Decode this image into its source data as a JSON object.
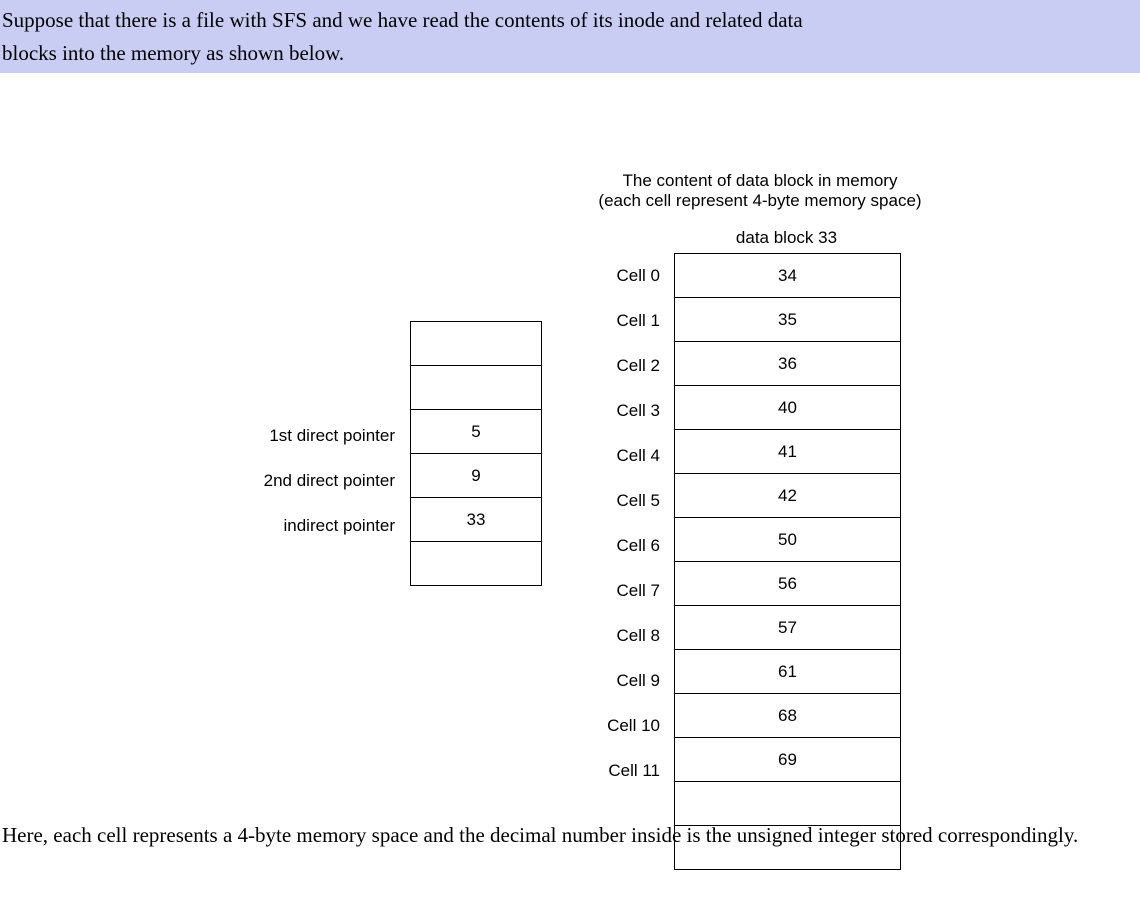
{
  "intro_line1": "Suppose that there is a file with SFS and we have read the contents of its inode and related data",
  "intro_line2": "blocks into the memory as shown below.",
  "caption_line1": "The content of data block in memory",
  "caption_line2": "(each cell represent 4-byte memory space)",
  "inode": {
    "labels": [
      "1st direct pointer",
      "2nd direct pointer",
      "indirect pointer"
    ],
    "values": [
      "",
      "",
      "5",
      "9",
      "33",
      ""
    ]
  },
  "block": {
    "title": "data block 33",
    "cells": [
      {
        "label": "Cell 0",
        "value": "34"
      },
      {
        "label": "Cell 1",
        "value": "35"
      },
      {
        "label": "Cell 2",
        "value": "36"
      },
      {
        "label": "Cell 3",
        "value": "40"
      },
      {
        "label": "Cell 4",
        "value": "41"
      },
      {
        "label": "Cell 5",
        "value": "42"
      },
      {
        "label": "Cell 6",
        "value": "50"
      },
      {
        "label": "Cell 7",
        "value": "56"
      },
      {
        "label": "Cell 8",
        "value": "57"
      },
      {
        "label": "Cell 9",
        "value": "61"
      },
      {
        "label": "Cell 10",
        "value": "68"
      },
      {
        "label": "Cell 11",
        "value": "69"
      }
    ],
    "trailing_empty": 2
  },
  "footer": "Here, each cell represents a 4-byte memory space and the decimal number inside is the unsigned integer stored correspondingly."
}
